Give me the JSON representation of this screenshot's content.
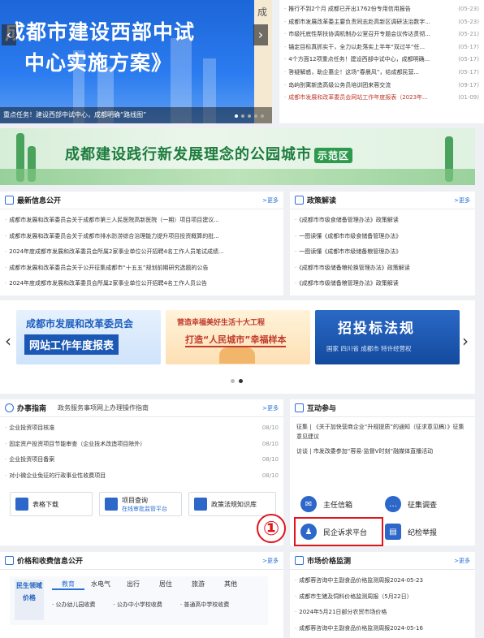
{
  "hero": {
    "line1": "成都市建设西部中试",
    "line2": "中心实施方案》",
    "partial_char": "成",
    "prev": "‹",
    "next": "›",
    "caption": "重点任务！建设西部中试中心，成都明确“路线图”"
  },
  "top_news": [
    {
      "text": "推行不到2个月 成都已开出1762份专用信用报告",
      "date": "(05-23)",
      "red": false
    },
    {
      "text": "成都市发展改革委主要负责同志赴高新区调研法治数字...",
      "date": "(05-23)",
      "red": false
    },
    {
      "text": "市级托底性帮扶协调机制办公室召开专题会议传达贯彻...",
      "date": "(05-21)",
      "red": false
    },
    {
      "text": "锚定目标真抓实干，全力以赴落实上半年“双过半”任...",
      "date": "(05-17)",
      "red": false
    },
    {
      "text": "4个方面12项重点任务！建设西部中试中心，成都明确...",
      "date": "(05-17)",
      "red": false
    },
    {
      "text": "答疑解惑，助企惠企！这场“春晨风”，给成都民营...",
      "date": "(05-17)",
      "red": false
    },
    {
      "text": "岛屿别寓新造高级公务员培训团来蓉交流",
      "date": "(09-17)",
      "red": false
    },
    {
      "text": "成都市发展和改革委员会网站工作年度报表（2023年...",
      "date": "(01-09)",
      "red": true
    }
  ],
  "banner": {
    "title": "成都建设践行新发展理念的公园城市",
    "badge": "示范区"
  },
  "latest_info": {
    "title": "最新信息公开",
    "more": ">更多",
    "items": [
      "成都市发展和改革委员会关于成都市第三人民医院高新医院（一期）项目项目建议...",
      "成都市发展和改革委员会关于成都市排水防涝综合治理能力提升项目投资概算的批...",
      "2024年度成都市发展和改革委员会所属2家事业单位公开招聘4名工作人员笔试成绩...",
      "成都市发展和改革委员会关于公开征集成都市“十五五”规划前期研究选题的公告",
      "2024年度成都市发展和改革委员会所属2家事业单位公开招聘4名工作人员公告"
    ]
  },
  "policy": {
    "title": "政策解读",
    "more": ">更多",
    "items": [
      "《成都市市级食储备管理办法》政策解读",
      "一图读懂《成都市市级食储备管理办法》",
      "一图读懂《成都市市级储备粮管理办法》",
      "《成都市市级储备粮轮换管理办法》政策解读",
      "《成都市市级储备粮管理办法》政策解读"
    ]
  },
  "slider": {
    "prev": "‹",
    "next": "›",
    "card1_line1": "成都市发展和改革委员会",
    "card1_line2": "网站工作年度报表",
    "card2_line1": "营造幸福美好生活十大工程",
    "card2_line2": "打造“人民城市”幸福样本",
    "card3_line1": "招投标法规",
    "card3_line2": "国家  四川省  成都市  特许经营权"
  },
  "guide": {
    "title": "办事指南",
    "subtitle": "政务服务事项网上办理操作指南",
    "more": ">更多",
    "items": [
      {
        "text": "企业投资项目核准",
        "date": "08/10"
      },
      {
        "text": "固定资产投资项目节能审查（企业技术改造项目除外）",
        "date": "08/10"
      },
      {
        "text": "企业投资项目备案",
        "date": "08/10"
      },
      {
        "text": "对小微企业免征的行政事业性收费项目",
        "date": "08/10"
      }
    ],
    "btn1": "表格下载",
    "btn2_line1": "项目查询",
    "btn2_line2": "在线审批监管平台",
    "btn3": "政策法规知识库"
  },
  "interaction": {
    "title": "互动参与",
    "more": ">更多",
    "items": [
      "征集 | 《关于加快营商企业“升规提质”的通知（征求意见稿）》征集意见建议",
      "访谈 | 市发改委参加“蓉易·监督V时刻”融媒体直播活动"
    ],
    "mailbox": "主任信箱",
    "survey": "征集调查",
    "appeal": "民企诉求平台",
    "report": "纪检举报"
  },
  "annotation": {
    "number": "①"
  },
  "price": {
    "title": "价格和收费信息公开",
    "more": ">更多",
    "side": "民生领域价格",
    "tabs": [
      "教育",
      "水电气",
      "出行",
      "居住",
      "旅游",
      "其他"
    ],
    "items": [
      "公办幼儿园收费",
      "公办中小学校收费",
      "普通高中学校收费"
    ]
  },
  "market": {
    "title": "市场价格监测",
    "more": ">更多",
    "items": [
      "成都蓉咨询中主副食品价格监测周报2024-05-23",
      "成都市生猪及饲料价格监测周报（5月22日）",
      "2024年5月21日部分农贸市场价格",
      "成都蓉咨询中主副食品价格监测周报2024-05-16"
    ]
  },
  "colors": {
    "accent": "#2b6fd6",
    "highlight": "#e0151c",
    "green": "#1e7c3e"
  }
}
